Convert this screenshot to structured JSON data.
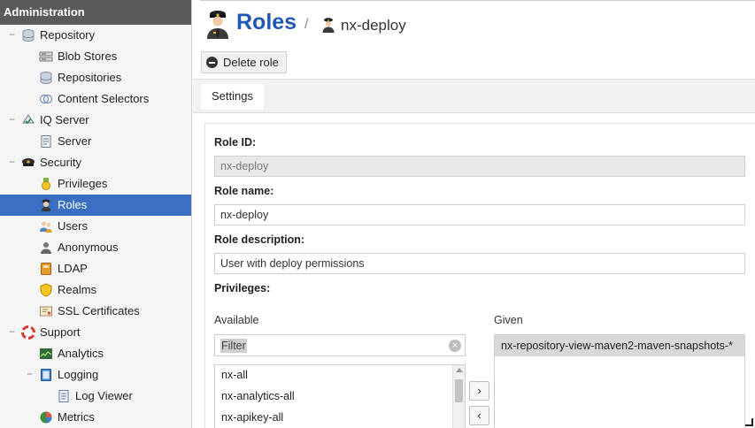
{
  "sidebar": {
    "header": "Administration",
    "items": [
      {
        "label": "Repository",
        "level": 0,
        "toggle": "−"
      },
      {
        "label": "Blob Stores",
        "level": 1
      },
      {
        "label": "Repositories",
        "level": 1
      },
      {
        "label": "Content Selectors",
        "level": 1
      },
      {
        "label": "IQ Server",
        "level": 0,
        "toggle": "−"
      },
      {
        "label": "Server",
        "level": 1
      },
      {
        "label": "Security",
        "level": 0,
        "toggle": "−"
      },
      {
        "label": "Privileges",
        "level": 1
      },
      {
        "label": "Roles",
        "level": 1,
        "selected": true
      },
      {
        "label": "Users",
        "level": 1
      },
      {
        "label": "Anonymous",
        "level": 1
      },
      {
        "label": "LDAP",
        "level": 1
      },
      {
        "label": "Realms",
        "level": 1
      },
      {
        "label": "SSL Certificates",
        "level": 1
      },
      {
        "label": "Support",
        "level": 0,
        "toggle": "−"
      },
      {
        "label": "Analytics",
        "level": 1
      },
      {
        "label": "Logging",
        "level": 1,
        "toggle": "−"
      },
      {
        "label": "Log Viewer",
        "level": 2
      },
      {
        "label": "Metrics",
        "level": 1
      }
    ]
  },
  "header": {
    "title": "Roles",
    "separator": "/",
    "subtitle": "nx-deploy"
  },
  "toolbar": {
    "delete_label": "Delete role"
  },
  "tabs": [
    {
      "label": "Settings",
      "active": true
    }
  ],
  "form": {
    "role_id_label": "Role ID:",
    "role_id_value": "nx-deploy",
    "role_name_label": "Role name:",
    "role_name_value": "nx-deploy",
    "role_description_label": "Role description:",
    "role_description_value": "User with deploy permissions",
    "privileges_label": "Privileges:"
  },
  "privileges": {
    "available_label": "Available",
    "given_label": "Given",
    "filter_placeholder": "Filter",
    "clear_symbol": "×",
    "available_items": [
      "nx-all",
      "nx-analytics-all",
      "nx-apikey-all"
    ],
    "given_items": [
      "nx-repository-view-maven2-maven-snapshots-*"
    ],
    "move_right_symbol": "›",
    "move_left_symbol": "‹"
  },
  "colors": {
    "accent": "#1f57b3",
    "selected_row": "#3b6fc4",
    "sidebar_header": "#5a5a5a"
  }
}
